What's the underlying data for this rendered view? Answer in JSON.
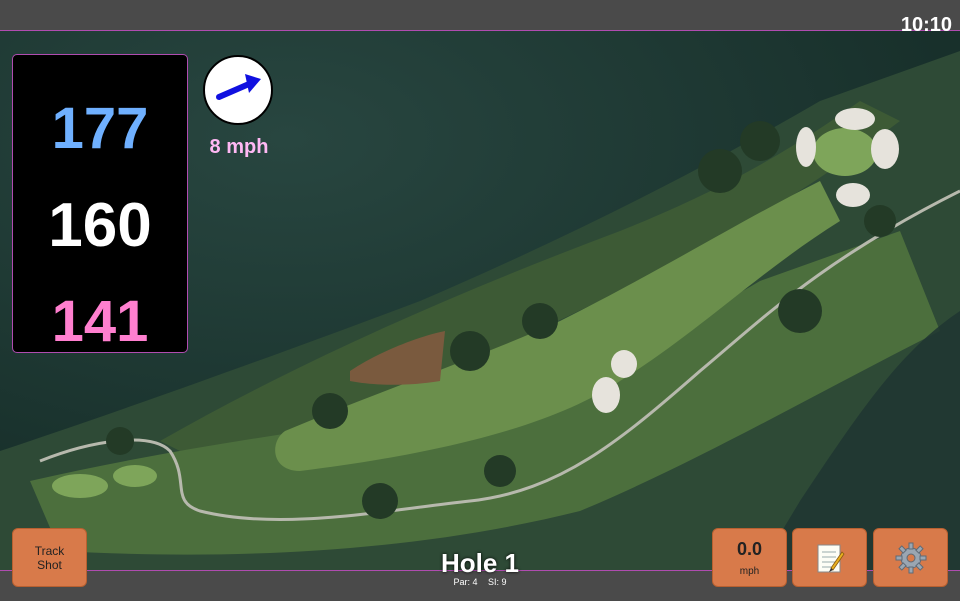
{
  "status": {
    "time": "10:10"
  },
  "distances": {
    "back": "177",
    "middle": "160",
    "front": "141"
  },
  "wind": {
    "speed": "8 mph",
    "icon": "wind-arrow-icon"
  },
  "hole": {
    "title": "Hole 1",
    "par": "Par: 4",
    "si": "SI: 9"
  },
  "buttons": {
    "track_line1": "Track",
    "track_line2": "Shot",
    "speed_value": "0.0",
    "speed_unit": "mph",
    "notes_icon": "notepad-icon",
    "settings_icon": "gear-icon"
  },
  "colors": {
    "back": "#6fb0ff",
    "middle": "#ffffff",
    "front": "#ff7fcf",
    "accent_border": "#b04cb0",
    "button": "#d87a4a"
  }
}
